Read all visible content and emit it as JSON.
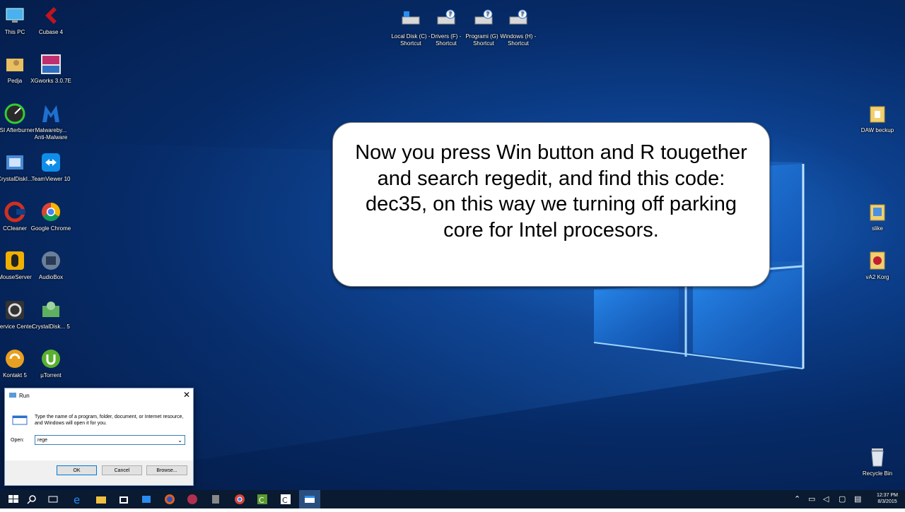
{
  "desktop": {
    "left_icons": [
      {
        "label": "This PC",
        "icon": "this-pc-icon"
      },
      {
        "label": "Cubase 4",
        "icon": "cubase-icon"
      },
      {
        "label": "Pedja",
        "icon": "user-folder-icon"
      },
      {
        "label": "XGworks 3.0.7E",
        "icon": "xgworks-icon"
      },
      {
        "label": "MSI Afterburner",
        "icon": "msi-afterburner-icon"
      },
      {
        "label": "Malwareby... Anti-Malware",
        "icon": "malwarebytes-icon"
      },
      {
        "label": "CrystalDiskI...",
        "icon": "crystaldiskinfo-icon"
      },
      {
        "label": "TeamViewer 10",
        "icon": "teamviewer-icon"
      },
      {
        "label": "CCleaner",
        "icon": "ccleaner-icon"
      },
      {
        "label": "Google Chrome",
        "icon": "chrome-icon"
      },
      {
        "label": "MouseServer",
        "icon": "mouseserver-icon"
      },
      {
        "label": "AudioBox",
        "icon": "audiobox-icon"
      },
      {
        "label": "Service Center",
        "icon": "service-center-icon"
      },
      {
        "label": "CrystalDisk... 5",
        "icon": "crystaldiskmark-icon"
      },
      {
        "label": "Kontakt 5",
        "icon": "kontakt-icon"
      },
      {
        "label": "µTorrent",
        "icon": "utorrent-icon"
      }
    ],
    "top_icons": [
      {
        "label": "Local Disk (C) - Shortcut",
        "icon": "local-disk-shortcut-icon"
      },
      {
        "label": "Drivers (F) - Shortcut",
        "icon": "drive-shortcut-icon"
      },
      {
        "label": "Programi (G) - Shortcut",
        "icon": "drive-shortcut-icon"
      },
      {
        "label": "Windows (H) - Shortcut",
        "icon": "drive-shortcut-icon"
      }
    ],
    "right_icons": [
      {
        "label": "DAW beckup",
        "icon": "folder-icon"
      },
      {
        "label": "slike",
        "icon": "folder-icon"
      },
      {
        "label": "vA2 Korg",
        "icon": "korg-icon"
      },
      {
        "label": "Recycle Bin",
        "icon": "recycle-bin-icon"
      }
    ]
  },
  "annotation": {
    "text": "Now you press Win button and R tougether and search regedit, and find this code: dec35, on this way we turning off parking core for Intel procesors."
  },
  "run_dialog": {
    "title": "Run",
    "close": "✕",
    "description": "Type the name of a program, folder, document, or Internet resource, and Windows will open it for you.",
    "open_label": "Open:",
    "input_value": "rege",
    "ok": "OK",
    "cancel": "Cancel",
    "browse": "Browse..."
  },
  "taskbar": {
    "time": "12:37 PM",
    "date": "8/3/2015",
    "pinned": [
      "start-icon",
      "search-icon",
      "task-view-icon",
      "edge-icon",
      "file-explorer-icon",
      "store-icon",
      "app-icon",
      "firefox-icon",
      "app-icon",
      "app-icon",
      "chrome-icon",
      "camtasia-icon",
      "camtasia-recorder-icon",
      "app-icon"
    ]
  }
}
